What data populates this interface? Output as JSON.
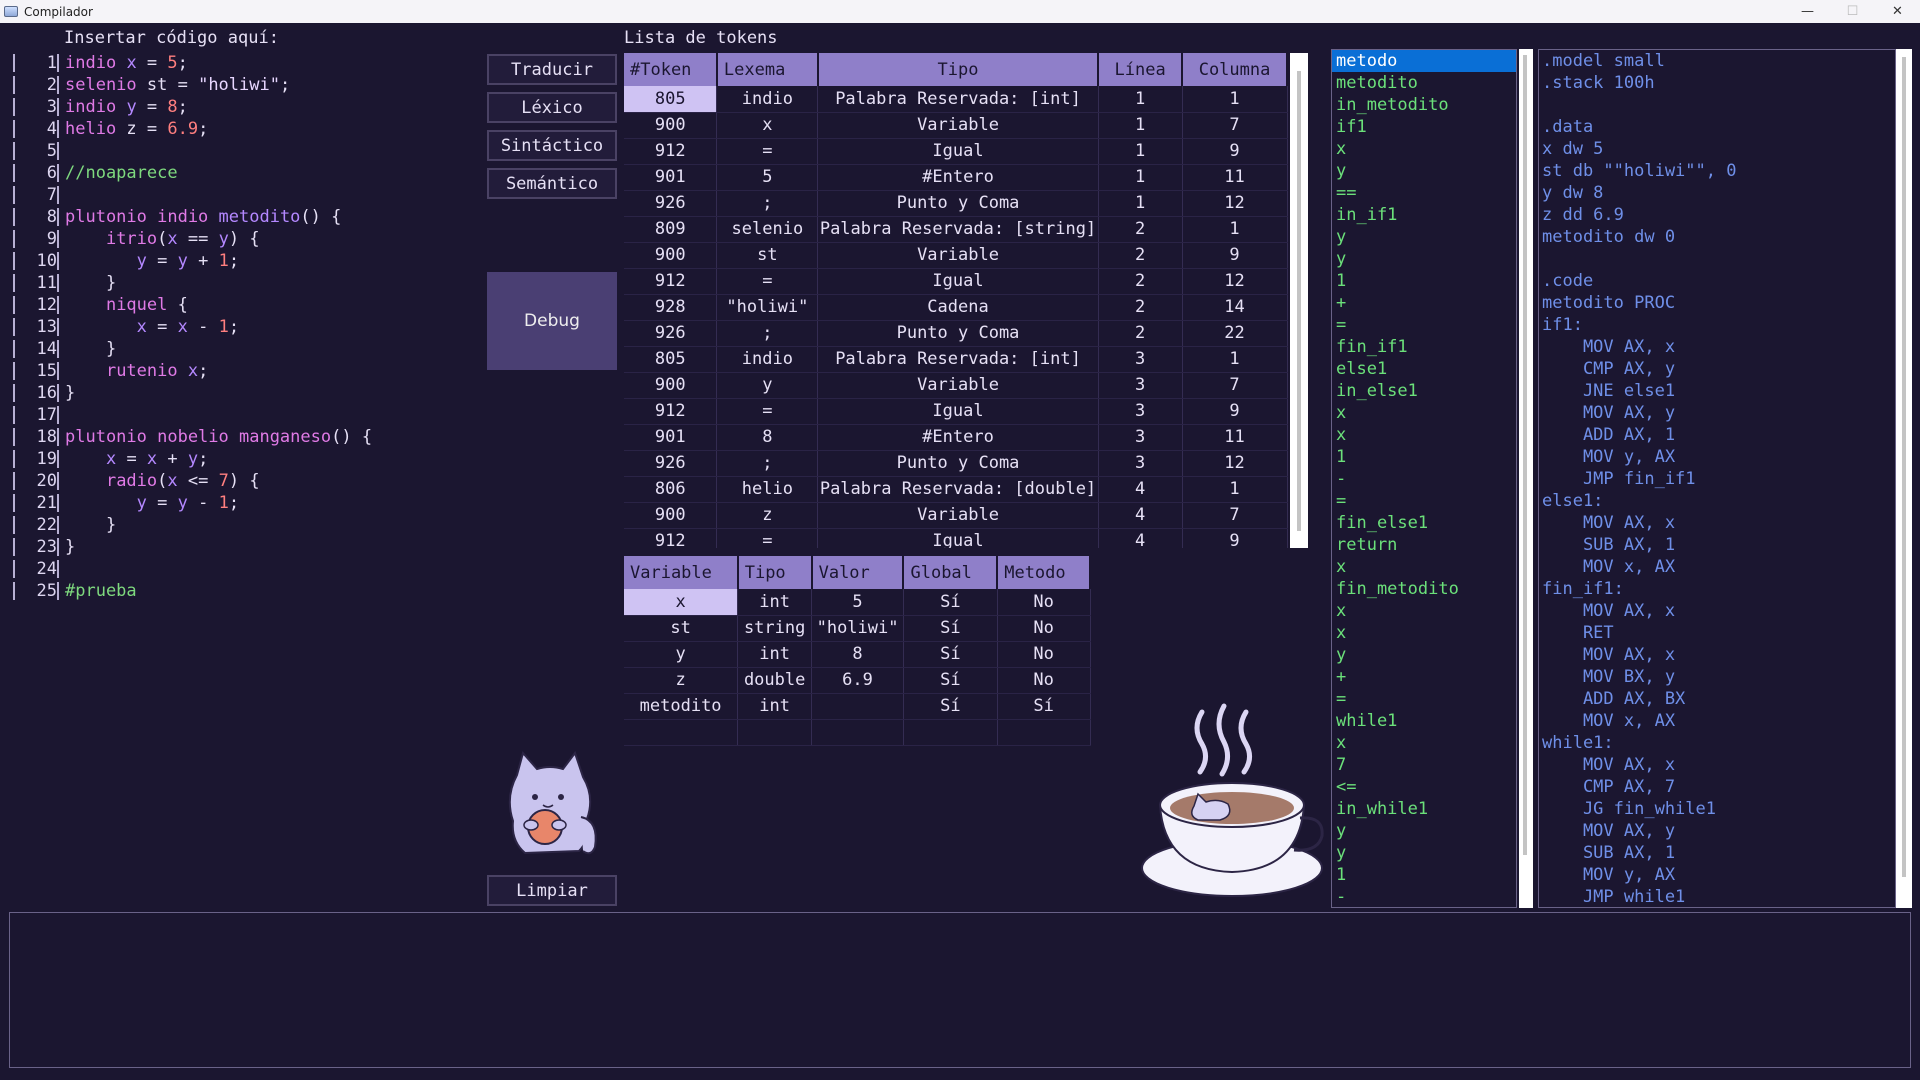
{
  "window": {
    "title": "Compilador",
    "minimize": "—",
    "maximize": "☐",
    "close": "✕"
  },
  "editor": {
    "label": "Insertar código aquí:",
    "lines": [
      {
        "n": "1",
        "tokens": [
          [
            "kw",
            "indio"
          ],
          [
            "pl",
            " "
          ],
          [
            "id",
            "x"
          ],
          [
            "pl",
            " = "
          ],
          [
            "num",
            "5"
          ],
          [
            "pl",
            ";"
          ]
        ]
      },
      {
        "n": "2",
        "tokens": [
          [
            "kw",
            "selenio"
          ],
          [
            "pl",
            " st = "
          ],
          [
            "str",
            "\"holiwi\""
          ],
          [
            "pl",
            ";"
          ]
        ]
      },
      {
        "n": "3",
        "tokens": [
          [
            "kw",
            "indio"
          ],
          [
            "pl",
            " "
          ],
          [
            "id",
            "y"
          ],
          [
            "pl",
            " = "
          ],
          [
            "num",
            "8"
          ],
          [
            "pl",
            ";"
          ]
        ]
      },
      {
        "n": "4",
        "tokens": [
          [
            "kw",
            "helio"
          ],
          [
            "pl",
            " z = "
          ],
          [
            "num",
            "6.9"
          ],
          [
            "pl",
            ";"
          ]
        ]
      },
      {
        "n": "5",
        "tokens": []
      },
      {
        "n": "6",
        "tokens": [
          [
            "cm",
            "//noaparece"
          ]
        ]
      },
      {
        "n": "7",
        "tokens": []
      },
      {
        "n": "8",
        "tokens": [
          [
            "kw",
            "plutonio indio "
          ],
          [
            "fn",
            "metodito"
          ],
          [
            "pl",
            "() {"
          ]
        ]
      },
      {
        "n": "9",
        "tokens": [
          [
            "pl",
            "    "
          ],
          [
            "kw",
            "itrio"
          ],
          [
            "pl",
            "("
          ],
          [
            "id",
            "x"
          ],
          [
            "pl",
            " == "
          ],
          [
            "id",
            "y"
          ],
          [
            "pl",
            ") {"
          ]
        ]
      },
      {
        "n": "10",
        "tokens": [
          [
            "pl",
            "       "
          ],
          [
            "id",
            "y"
          ],
          [
            "pl",
            " = "
          ],
          [
            "id",
            "y"
          ],
          [
            "pl",
            " + "
          ],
          [
            "num",
            "1"
          ],
          [
            "pl",
            ";"
          ]
        ]
      },
      {
        "n": "11",
        "tokens": [
          [
            "pl",
            "    }"
          ]
        ]
      },
      {
        "n": "12",
        "tokens": [
          [
            "pl",
            "    "
          ],
          [
            "kw",
            "niquel"
          ],
          [
            "pl",
            " {"
          ]
        ]
      },
      {
        "n": "13",
        "tokens": [
          [
            "pl",
            "       "
          ],
          [
            "id",
            "x"
          ],
          [
            "pl",
            " = "
          ],
          [
            "id",
            "x"
          ],
          [
            "pl",
            " - "
          ],
          [
            "num",
            "1"
          ],
          [
            "pl",
            ";"
          ]
        ]
      },
      {
        "n": "14",
        "tokens": [
          [
            "pl",
            "    }"
          ]
        ]
      },
      {
        "n": "15",
        "tokens": [
          [
            "pl",
            "    "
          ],
          [
            "kw",
            "rutenio"
          ],
          [
            "pl",
            " "
          ],
          [
            "id",
            "x"
          ],
          [
            "pl",
            ";"
          ]
        ]
      },
      {
        "n": "16",
        "tokens": [
          [
            "pl",
            "}"
          ]
        ]
      },
      {
        "n": "17",
        "tokens": []
      },
      {
        "n": "18",
        "tokens": [
          [
            "kw",
            "plutonio nobelio manganeso"
          ],
          [
            "pl",
            "() {"
          ]
        ]
      },
      {
        "n": "19",
        "tokens": [
          [
            "pl",
            "    "
          ],
          [
            "id",
            "x"
          ],
          [
            "pl",
            " = "
          ],
          [
            "id",
            "x"
          ],
          [
            "pl",
            " + "
          ],
          [
            "id",
            "y"
          ],
          [
            "pl",
            ";"
          ]
        ]
      },
      {
        "n": "20",
        "tokens": [
          [
            "pl",
            "    "
          ],
          [
            "kw",
            "radio"
          ],
          [
            "pl",
            "("
          ],
          [
            "id",
            "x"
          ],
          [
            "pl",
            " <= "
          ],
          [
            "num",
            "7"
          ],
          [
            "pl",
            ") {"
          ]
        ]
      },
      {
        "n": "21",
        "tokens": [
          [
            "pl",
            "       "
          ],
          [
            "id",
            "y"
          ],
          [
            "pl",
            " = "
          ],
          [
            "id",
            "y"
          ],
          [
            "pl",
            " - "
          ],
          [
            "num",
            "1"
          ],
          [
            "pl",
            ";"
          ]
        ]
      },
      {
        "n": "22",
        "tokens": [
          [
            "pl",
            "    }"
          ]
        ]
      },
      {
        "n": "23",
        "tokens": [
          [
            "pl",
            "}"
          ]
        ]
      },
      {
        "n": "24",
        "tokens": []
      },
      {
        "n": "25",
        "tokens": [
          [
            "cm",
            "#prueba"
          ]
        ]
      }
    ]
  },
  "buttons": {
    "translate": "Traducir",
    "lexical": "Léxico",
    "syntactic": "Sintáctico",
    "semantic": "Semántico",
    "debug": "Debug",
    "clear": "Limpiar"
  },
  "tokens": {
    "label": "Lista de tokens",
    "headers": [
      "#Token",
      "Lexema",
      "Tipo",
      "Línea",
      "Columna"
    ],
    "rows": [
      [
        "805",
        "indio",
        "Palabra Reservada: [int]",
        "1",
        "1"
      ],
      [
        "900",
        "x",
        "Variable",
        "1",
        "7"
      ],
      [
        "912",
        "=",
        "Igual",
        "1",
        "9"
      ],
      [
        "901",
        "5",
        "#Entero",
        "1",
        "11"
      ],
      [
        "926",
        ";",
        "Punto y Coma",
        "1",
        "12"
      ],
      [
        "809",
        "selenio",
        "Palabra Reservada: [string]",
        "2",
        "1"
      ],
      [
        "900",
        "st",
        "Variable",
        "2",
        "9"
      ],
      [
        "912",
        "=",
        "Igual",
        "2",
        "12"
      ],
      [
        "928",
        "\"holiwi\"",
        "Cadena",
        "2",
        "14"
      ],
      [
        "926",
        ";",
        "Punto y Coma",
        "2",
        "22"
      ],
      [
        "805",
        "indio",
        "Palabra Reservada: [int]",
        "3",
        "1"
      ],
      [
        "900",
        "y",
        "Variable",
        "3",
        "7"
      ],
      [
        "912",
        "=",
        "Igual",
        "3",
        "9"
      ],
      [
        "901",
        "8",
        "#Entero",
        "3",
        "11"
      ],
      [
        "926",
        ";",
        "Punto y Coma",
        "3",
        "12"
      ],
      [
        "806",
        "helio",
        "Palabra Reservada: [double]",
        "4",
        "1"
      ],
      [
        "900",
        "z",
        "Variable",
        "4",
        "7"
      ],
      [
        "912",
        "=",
        "Igual",
        "4",
        "9"
      ]
    ]
  },
  "variables": {
    "headers": [
      "Variable",
      "Tipo",
      "Valor",
      "Global",
      "Metodo"
    ],
    "rows": [
      [
        "x",
        "int",
        "5",
        "Sí",
        "No"
      ],
      [
        "st",
        "string",
        "\"holiwi\"",
        "Sí",
        "No"
      ],
      [
        "y",
        "int",
        "8",
        "Sí",
        "No"
      ],
      [
        "z",
        "double",
        "6.9",
        "Sí",
        "No"
      ],
      [
        "metodito",
        "int",
        "",
        "Sí",
        "Sí"
      ],
      [
        "",
        "",
        "",
        "",
        ""
      ]
    ]
  },
  "triplets": [
    "metodo",
    "metodito",
    "in_metodito",
    "if1",
    "x",
    "y",
    "==",
    "in_if1",
    "y",
    "y",
    "1",
    "+",
    "=",
    "fin_if1",
    "else1",
    "in_else1",
    "x",
    "x",
    "1",
    "-",
    "=",
    "fin_else1",
    "return",
    "x",
    "fin_metodito",
    "x",
    "x",
    "y",
    "+",
    "=",
    "while1",
    "x",
    "7",
    "<=",
    "in_while1",
    "y",
    "y",
    "1",
    "-"
  ],
  "asm": [
    ".model small",
    ".stack 100h",
    "",
    ".data",
    "x dw 5",
    "st db \"\"holiwi\"\", 0",
    "y dw 8",
    "z dd 6.9",
    "metodito dw 0",
    "",
    ".code",
    "metodito PROC",
    "if1:",
    "    MOV AX, x",
    "    CMP AX, y",
    "    JNE else1",
    "    MOV AX, y",
    "    ADD AX, 1",
    "    MOV y, AX",
    "    JMP fin_if1",
    "else1:",
    "    MOV AX, x",
    "    SUB AX, 1",
    "    MOV x, AX",
    "fin_if1:",
    "    MOV AX, x",
    "    RET",
    "    MOV AX, x",
    "    MOV BX, y",
    "    ADD AX, BX",
    "    MOV x, AX",
    "while1:",
    "    MOV AX, x",
    "    CMP AX, 7",
    "    JG fin_while1",
    "    MOV AX, y",
    "    SUB AX, 1",
    "    MOV y, AX",
    "    JMP while1"
  ],
  "console": {
    "output": ""
  }
}
